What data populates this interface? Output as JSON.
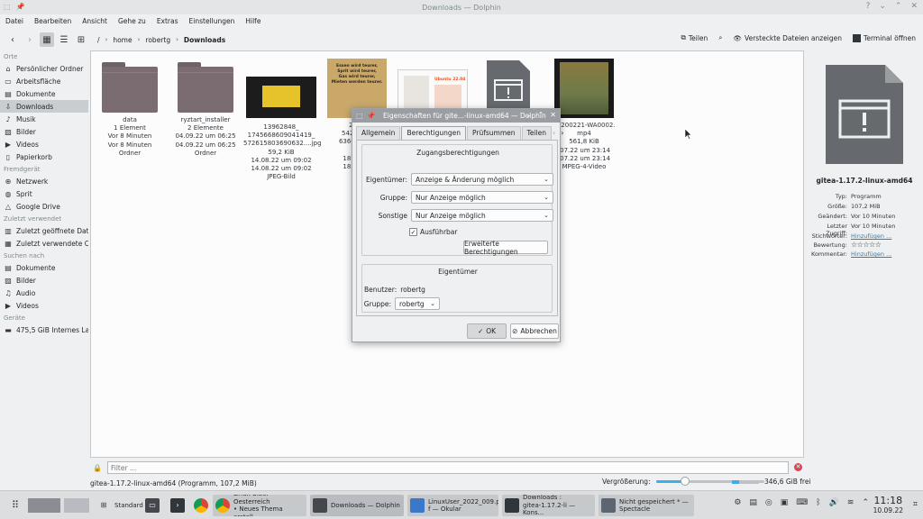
{
  "window": {
    "title": "Downloads — Dolphin"
  },
  "menu": [
    "Datei",
    "Bearbeiten",
    "Ansicht",
    "Gehe zu",
    "Extras",
    "Einstellungen",
    "Hilfe"
  ],
  "breadcrumb": {
    "root": "/",
    "items": [
      "home",
      "robertg"
    ],
    "current": "Downloads"
  },
  "toolbar_right": {
    "split": "Teilen",
    "hidden_files": "Versteckte Dateien anzeigen",
    "terminal": "Terminal öffnen"
  },
  "sidebar": {
    "sections": [
      {
        "title": "Orte",
        "items": [
          {
            "label": "Persönlicher Ordner",
            "icon": "home-icon"
          },
          {
            "label": "Arbeitsfläche",
            "icon": "desktop-icon"
          },
          {
            "label": "Dokumente",
            "icon": "documents-icon"
          },
          {
            "label": "Downloads",
            "icon": "download-icon",
            "selected": true
          },
          {
            "label": "Musik",
            "icon": "music-icon"
          },
          {
            "label": "Bilder",
            "icon": "pictures-icon"
          },
          {
            "label": "Videos",
            "icon": "videos-icon"
          },
          {
            "label": "Papierkorb",
            "icon": "trash-icon"
          }
        ]
      },
      {
        "title": "Fremdgerät",
        "items": [
          {
            "label": "Netzwerk",
            "icon": "network-icon"
          },
          {
            "label": "Sprit",
            "icon": "globe-icon"
          },
          {
            "label": "Google Drive",
            "icon": "drive-icon"
          }
        ]
      },
      {
        "title": "Zuletzt verwendet",
        "items": [
          {
            "label": "Zuletzt geöffnete Dat...",
            "icon": "recent-files-icon"
          },
          {
            "label": "Zuletzt verwendete O...",
            "icon": "recent-folders-icon"
          }
        ]
      },
      {
        "title": "Suchen nach",
        "items": [
          {
            "label": "Dokumente",
            "icon": "documents-icon"
          },
          {
            "label": "Bilder",
            "icon": "pictures-icon"
          },
          {
            "label": "Audio",
            "icon": "audio-icon"
          },
          {
            "label": "Videos",
            "icon": "videos-icon"
          }
        ]
      },
      {
        "title": "Geräte",
        "items": [
          {
            "label": "475,5 GiB Internes La...",
            "icon": "drive-disk-icon"
          }
        ]
      }
    ]
  },
  "files": [
    {
      "name": "data",
      "lines": [
        "1 Element",
        "Vor 8 Minuten",
        "Vor 8 Minuten",
        "Ordner"
      ],
      "kind": "folder"
    },
    {
      "name": "ryztart_installer",
      "lines": [
        "2 Elemente",
        "04.09.22 um 06:25",
        "04.09.22 um 06:25",
        "Ordner"
      ],
      "kind": "folder"
    },
    {
      "name": "13962848_\n1745668609041419_\n572615803690632....jpg",
      "lines": [
        "59,2 KiB",
        "14.08.22 um 09:02",
        "14.08.22 um 09:02",
        "JPEG-Bild"
      ],
      "kind": "image-yellow"
    },
    {
      "name": "2984\n5422801(\n636001784",
      "lines": [
        "107",
        "18.08.22",
        "18.08.22",
        "JPE"
      ],
      "kind": "image-poster"
    },
    {
      "name": "",
      "lines": [],
      "kind": "image-doc"
    },
    {
      "name": "",
      "lines": [],
      "kind": "exec"
    },
    {
      "name": "20200221-WA0002.\nmp4",
      "lines": [
        "561,8 KiB",
        ".07.22 um 23:14",
        ".07.22 um 23:14",
        "MPEG-4-Video"
      ],
      "kind": "video"
    }
  ],
  "poster_text": "Essen wird teurer,\nSprit wird teurer,\nGas wird teurer,\nMieten werden teurer.",
  "doc_thumb_text": "Ubuntu 22.04",
  "filter": {
    "placeholder": "Filter ..."
  },
  "status": {
    "selection": "gitea-1.17.2-linux-amd64 (Programm, 107,2 MiB)",
    "zoom_label": "Vergrößerung:",
    "zoom_level": 0.27,
    "free": "346,6 GiB frei",
    "free_fraction": 0.27
  },
  "info": {
    "name": "gitea-1.17.2-linux-amd64",
    "rows": [
      {
        "k": "Typ:",
        "v": "Programm"
      },
      {
        "k": "Größe:",
        "v": "107,2 MiB"
      },
      {
        "k": "Geändert:",
        "v": "Vor 10 Minuten"
      },
      {
        "k": "Letzter Zugriff:",
        "v": "Vor 10 Minuten"
      },
      {
        "k": "Stichwörter:",
        "v": "Hinzufügen ...",
        "link": true
      },
      {
        "k": "Bewertung:",
        "v": "☆☆☆☆☆",
        "stars": true
      },
      {
        "k": "Kommentar:",
        "v": "Hinzufügen ...",
        "link": true
      }
    ]
  },
  "dialog": {
    "title": "Eigenschaften für gite...-linux-amd64 — Dolphin",
    "tabs": [
      "Allgemein",
      "Berechtigungen",
      "Prüfsummen",
      "Teilen"
    ],
    "selected_tab": 1,
    "access": {
      "title": "Zugangsberechtigungen",
      "owner_label": "Eigentümer:",
      "owner_value": "Anzeige & Änderung möglich",
      "group_label": "Gruppe:",
      "group_value": "Nur Anzeige möglich",
      "others_label": "Sonstige",
      "others_value": "Nur Anzeige möglich",
      "exec_label": "Ausführbar",
      "exec_checked": true,
      "advanced": "Erweiterte Berechtigungen"
    },
    "ownership": {
      "title": "Eigentümer",
      "user_label": "Benutzer:",
      "user_value": "robertg",
      "group_label": "Gruppe:",
      "group_value": "robertg"
    },
    "ok": "OK",
    "cancel": "Abbrechen"
  },
  "taskbar": {
    "launcher_label": "Standard",
    "tasks": [
      {
        "label": "Linux Bibel Oesterreich\n• Neues Thema erstell...",
        "icon": "chrome-icon"
      },
      {
        "label": "Downloads — Dolphin",
        "icon": "dolphin-icon",
        "active": true
      },
      {
        "label": "LinuxUser_2022_009.pd\nf — Okular",
        "icon": "okular-icon"
      },
      {
        "label": "Downloads :\ngitea-1.17.2-li — Kons...",
        "icon": "konsole-icon"
      },
      {
        "label": "Nicht gespeichert * —\nSpectacle",
        "icon": "spectacle-icon"
      }
    ],
    "time": "11:18",
    "date": "10.09.22"
  },
  "colors": {
    "accent": "#3daee9",
    "titlebar_dialog": "#9a9ea2",
    "folder": "#7a6c70"
  }
}
